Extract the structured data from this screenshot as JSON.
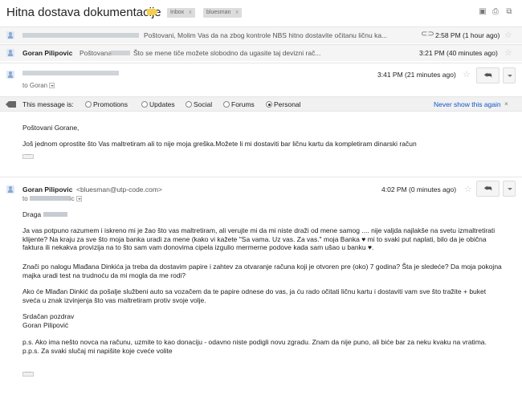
{
  "thread": {
    "subject": "Hitna dostava dokumentacije",
    "labels": [
      "Inbox",
      "bluesman"
    ],
    "label_close": "x"
  },
  "messages": [
    {
      "sender": "",
      "snippet": "Poštovani, Molim Vas da na zbog kontrole NBS hitno dostavite očitanu ličnu ka...",
      "time": "2:58 PM (1 hour ago)"
    },
    {
      "sender": "Goran Pilipovic",
      "snippet_pre": "Poštovana",
      "snippet_post": "Što se mene tiče možete slobodno da ugasite taj devizni rač...",
      "time": "3:21 PM (40 minutes ago)"
    },
    {
      "to": "to Goran",
      "time": "3:41 PM (21 minutes ago)",
      "body": [
        "Poštovani Gorane,",
        "Još jednom oprostite što Vas maltretiram ali to nije moja greška.Možete li mi dostaviti bar ličnu kartu da kompletiram dinarski račun"
      ]
    },
    {
      "sender": "Goran Pilipovic",
      "email": "<bluesman@utp-code.com>",
      "to_pre": "to",
      "to_post": "ic",
      "time": "4:02 PM (0 minutes ago)",
      "greeting": "Draga",
      "paragraphs": [
        "Ja vas potpuno razumem i iskreno mi je žao što vas maltretiram, ali verujte mi da mi niste draži od mene samog .... nije valjda najlakše na svetu izmaltretirati klijente? Na kraju za sve što moja banka uradi za mene (kako vi kažete \"Sa vama. Uz vas. Za vas.\" moja Banka ♥ mi to svaki put naplati, bilo da je obična faktura ili nekakva provizija na to što sam vam donovima cipela izgulio mermerne podove kada sam ušao u banku ♥.",
        "Znači po nalogu Mlađana Dinkića ja treba da dostavim papire i zahtev za otvaranje računa koji je otvoren pre (oko) 7 godina? Šta je sledeće? Da moja pokojna majka uradi test na trudnoću da mi mogla da me rodi?",
        "Ako će Mlađan Dinkić da pošalje službeni auto sa vozačem da te papire odnese do vas, ja ću rado očitati ličnu kartu i dostaviti vam sve što tražite + buket sveća u znak izvinjenja što vas maltretiram protiv svoje volje.",
        "Srdačan pozdrav\nGoran Pilipović",
        "p.s. Ako ima nešto novca na računu, uzmite to kao donaciju - odavno niste podigli novu zgradu. Znam da nije puno, ali biće bar za neku kvaku na vratima.\np.p.s. Za svaki slučaj mi napišite koje cveće volite"
      ]
    }
  ],
  "message_bar": {
    "prefix": "This message is:",
    "options": [
      "Promotions",
      "Updates",
      "Social",
      "Forums",
      "Personal"
    ],
    "selected": "Personal",
    "never": "Never show this again",
    "close": "×"
  }
}
